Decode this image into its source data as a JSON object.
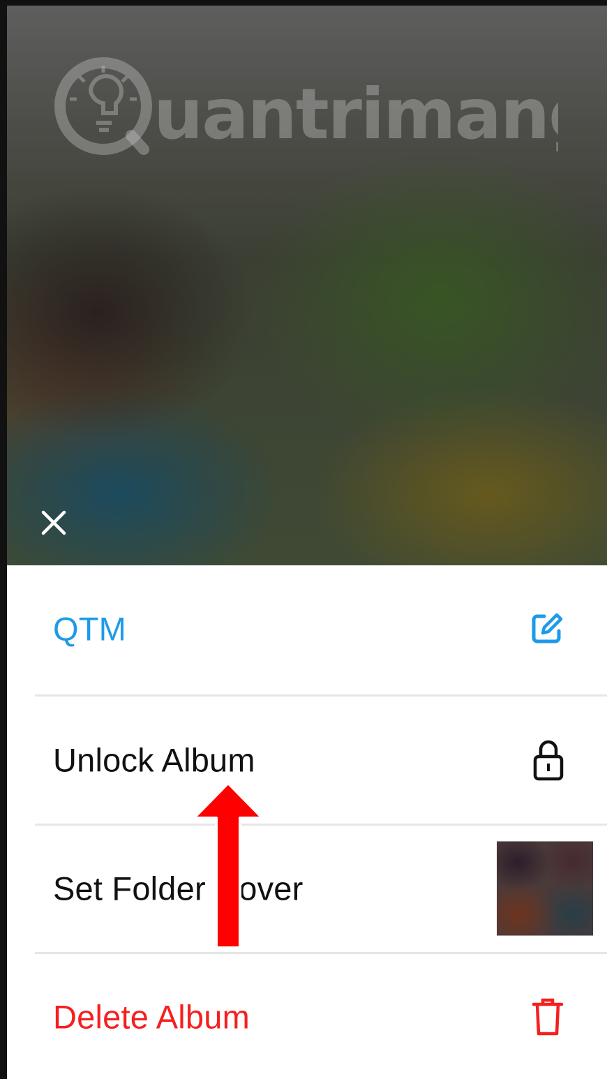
{
  "hero": {
    "watermark_text": "uantrimang",
    "close_icon": "close-icon"
  },
  "sheet": {
    "title": {
      "label": "QTM",
      "icon": "edit-icon",
      "color": "#1e9be8"
    },
    "items": [
      {
        "label": "Unlock Album",
        "icon": "lock-icon"
      },
      {
        "label": "Set Folder Cover",
        "icon": "cover-thumbnail"
      },
      {
        "label": "Delete Album",
        "icon": "trash-icon",
        "color": "#f42020"
      }
    ]
  },
  "annotation": {
    "arrow_color": "#ff0000",
    "arrow_icon": "arrow-up-icon"
  }
}
